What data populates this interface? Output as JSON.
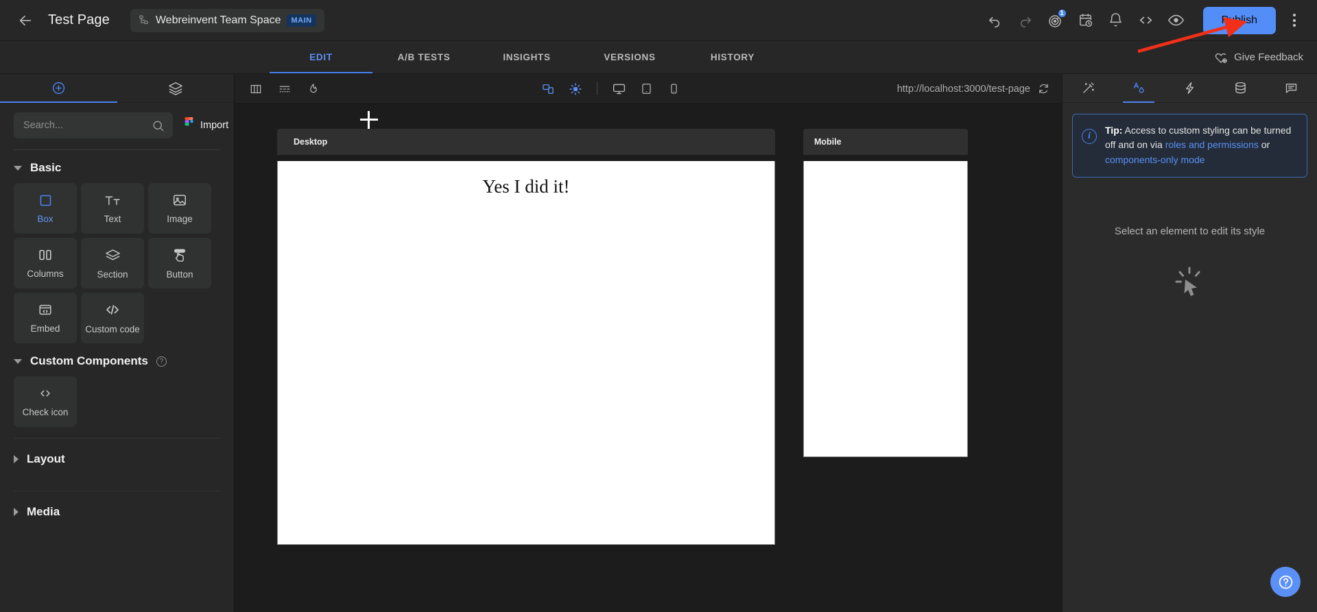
{
  "topbar": {
    "back_icon": "arrow-left-icon",
    "page_title": "Test Page",
    "space_name": "Webreinvent Team Space",
    "space_icon": "hierarchy-icon",
    "branch_badge": "MAIN",
    "icons": [
      {
        "name": "undo-icon",
        "label": "Undo"
      },
      {
        "name": "redo-icon",
        "label": "Redo"
      },
      {
        "name": "target-icon",
        "label": "Goals",
        "badge": "1"
      },
      {
        "name": "calendar-clock-icon",
        "label": "Schedule"
      },
      {
        "name": "bell-icon",
        "label": "Notifications"
      },
      {
        "name": "code-icon",
        "label": "Code"
      },
      {
        "name": "eye-icon",
        "label": "Preview"
      }
    ],
    "publish_label": "Publish",
    "kebab_icon": "more-vertical-icon"
  },
  "tabbar": {
    "tabs": [
      {
        "label": "EDIT",
        "active": true
      },
      {
        "label": "A/B TESTS",
        "active": false
      },
      {
        "label": "INSIGHTS",
        "active": false
      },
      {
        "label": "VERSIONS",
        "active": false
      },
      {
        "label": "HISTORY",
        "active": false
      }
    ],
    "feedback_label": "Give Feedback",
    "feedback_icon": "heart-plus-icon"
  },
  "left_panel": {
    "tabs": [
      {
        "name": "add-elements-tab",
        "icon": "plus-circle-icon",
        "active": true
      },
      {
        "name": "layers-tab",
        "icon": "layers-icon",
        "active": false
      }
    ],
    "search": {
      "placeholder": "Search...",
      "value": "",
      "icon": "search-icon"
    },
    "import_label": "Import",
    "import_icon": "figma-icon",
    "sections": [
      {
        "title": "Basic",
        "expanded": true,
        "items": [
          {
            "label": "Box",
            "icon": "square-icon",
            "selected": true
          },
          {
            "label": "Text",
            "icon": "text-size-icon",
            "selected": false
          },
          {
            "label": "Image",
            "icon": "image-icon",
            "selected": false
          },
          {
            "label": "Columns",
            "icon": "columns-icon",
            "selected": false
          },
          {
            "label": "Section",
            "icon": "layers-icon",
            "selected": false
          },
          {
            "label": "Button",
            "icon": "button-click-icon",
            "selected": false
          },
          {
            "label": "Embed",
            "icon": "embed-window-icon",
            "selected": false
          },
          {
            "label": "Custom code",
            "icon": "code-icon",
            "selected": false
          }
        ]
      },
      {
        "title": "Custom Components",
        "expanded": true,
        "has_help": true,
        "help_icon": "question-circle-icon",
        "items": [
          {
            "label": "Check icon",
            "icon": "code-icon",
            "selected": false
          }
        ]
      }
    ],
    "collapsed_sections": [
      {
        "title": "Layout"
      },
      {
        "title": "Media"
      }
    ]
  },
  "canvas": {
    "toolbar": {
      "left_icons": [
        {
          "name": "columns-layout-icon"
        },
        {
          "name": "spacing-guides-icon"
        },
        {
          "name": "flame-icon"
        }
      ],
      "device_icons": [
        {
          "name": "multi-device-icon",
          "active": true
        },
        {
          "name": "responsive-focus-icon",
          "active": true
        },
        {
          "name": "desktop-icon",
          "active": false
        },
        {
          "name": "tablet-icon",
          "active": false
        },
        {
          "name": "mobile-icon",
          "active": false
        }
      ],
      "url": "http://localhost:3000/test-page",
      "refresh_icon": "refresh-icon"
    },
    "frames": [
      {
        "name": "Desktop",
        "heading": "Yes I did it!"
      },
      {
        "name": "Mobile",
        "heading": ""
      }
    ],
    "cursor_icon": "crosshair-cursor"
  },
  "right_panel": {
    "tabs": [
      {
        "name": "design-tools-tab",
        "icon": "wand-icon",
        "active": false
      },
      {
        "name": "style-tab",
        "icon": "style-droplet-icon",
        "active": true
      },
      {
        "name": "interactions-tab",
        "icon": "lightning-icon",
        "active": false
      },
      {
        "name": "data-tab",
        "icon": "database-icon",
        "active": false
      },
      {
        "name": "comments-tab",
        "icon": "comment-icon",
        "active": false
      }
    ],
    "tip": {
      "prefix": "Tip:",
      "text_1": " Access to custom styling can be turned off and on via ",
      "link_1": "roles and permissions",
      "text_2": " or ",
      "link_2": "components-only mode",
      "icon": "info-icon"
    },
    "empty_message": "Select an element to edit its style",
    "empty_icon": "cursor-select-icon"
  },
  "help_fab": {
    "icon": "question-icon"
  },
  "colors": {
    "accent": "#538df7",
    "accent_tab": "#4a84f2",
    "topbar_bg": "#272727",
    "canvas_bg": "#1c1c1c",
    "panel_bg": "#2b2b2b",
    "annotation_arrow": "#f22f18",
    "branch_badge_bg": "#13345c"
  }
}
